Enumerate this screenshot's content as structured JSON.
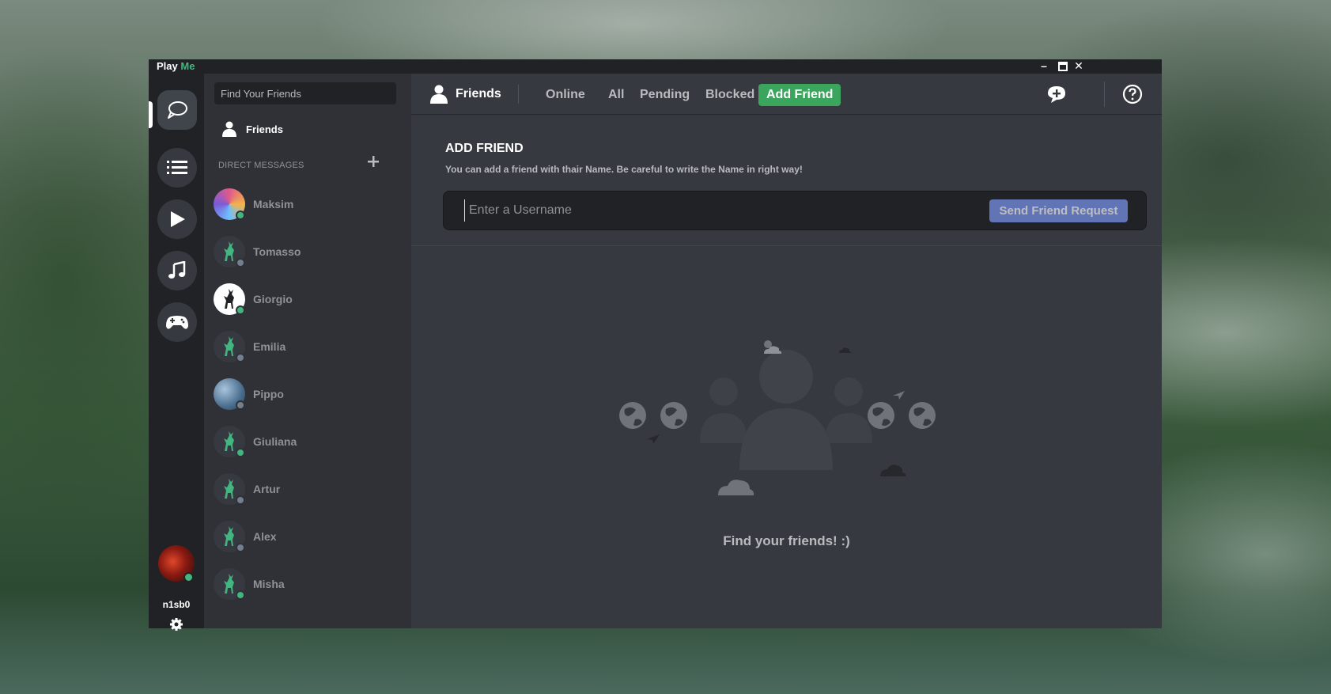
{
  "app": {
    "title_part1": "Play",
    "title_part2": "Me",
    "controls": {
      "minimize": "–",
      "maximize": "▢",
      "close": "✕"
    }
  },
  "rail": {
    "items": [
      "chat-icon",
      "list-icon",
      "play-icon",
      "music-icon",
      "gamepad-icon"
    ],
    "user": {
      "name": "n1sb0",
      "status": "online"
    }
  },
  "sidebar": {
    "search_placeholder": "Find Your Friends",
    "friends_label": "Friends",
    "dm_header": "DIRECT MESSAGES",
    "dm_add_icon": "plus-icon",
    "dms": [
      {
        "name": "Maksim",
        "status": "online",
        "avatar": "colorful"
      },
      {
        "name": "Tomasso",
        "status": "offline",
        "avatar": "deer"
      },
      {
        "name": "Giorgio",
        "status": "online",
        "avatar": "deer-white"
      },
      {
        "name": "Emilia",
        "status": "offline",
        "avatar": "deer"
      },
      {
        "name": "Pippo",
        "status": "offline",
        "avatar": "blue"
      },
      {
        "name": "Giuliana",
        "status": "online",
        "avatar": "deer"
      },
      {
        "name": "Artur",
        "status": "offline",
        "avatar": "deer"
      },
      {
        "name": "Alex",
        "status": "offline",
        "avatar": "deer"
      },
      {
        "name": "Misha",
        "status": "online",
        "avatar": "deer"
      }
    ]
  },
  "topbar": {
    "friends_label": "Friends",
    "tabs": [
      "Online",
      "All",
      "Pending",
      "Blocked",
      "Add Friend"
    ],
    "active_tab": "Add Friend"
  },
  "add_friend": {
    "title": "ADD FRIEND",
    "description": "You can add a friend with thair Name. Be careful to write the Name in right way!",
    "input_placeholder": "Enter a Username",
    "button_label": "Send Friend Request"
  },
  "empty_state": {
    "text": "Find your friends! :)"
  },
  "colors": {
    "accent_green": "#3ba55d",
    "online": "#43b581",
    "offline": "#747f8d",
    "blurple": "#7289da",
    "bg_dark": "#202225",
    "bg_mid": "#2f3136",
    "bg_main": "#36393f"
  }
}
